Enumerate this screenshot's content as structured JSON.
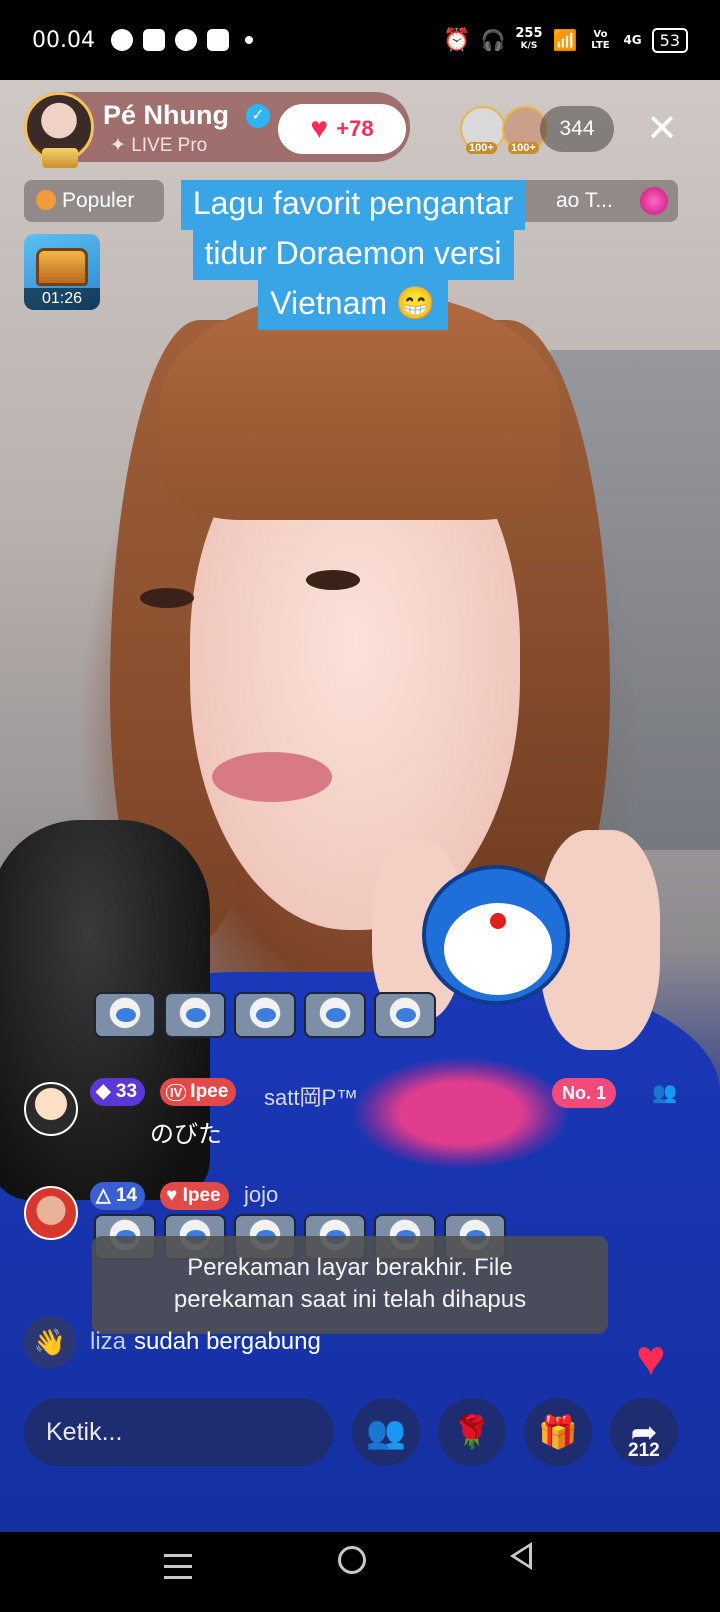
{
  "status_bar": {
    "time": "00.04",
    "speed_value": "255",
    "speed_unit": "K/S",
    "network_label": "Vo LTE",
    "signal_label": "4G",
    "battery": "53"
  },
  "live": {
    "host_name": "Pé Nhung",
    "host_subtitle": "✦ LIVE Pro",
    "likes": "+78",
    "viewer_badges": [
      "100+",
      "100+"
    ],
    "viewer_count": "344"
  },
  "chips": {
    "popular": "Populer",
    "right_chip": "ao T..."
  },
  "caption": {
    "lines": [
      "Lagu favorit pengantar",
      "tidur Doraemon versi",
      "Vietnam 😁"
    ]
  },
  "treasure": {
    "timer": "01:26"
  },
  "chat": [
    {
      "level": "33",
      "fan_badge": "Ipee",
      "fan_level": "IV",
      "name": "satt岡P™",
      "text": "のびた"
    },
    {
      "level": "14",
      "fan_badge": "Ipee",
      "name": "jojo",
      "text": ""
    }
  ],
  "rank_badge": "No. 1",
  "toast": {
    "line1": "Perekaman layar berakhir. File",
    "line2": "perekaman saat ini telah dihapus"
  },
  "join": {
    "name": "liza",
    "message": "sudah bergabung"
  },
  "bottom_bar": {
    "input_placeholder": "Ketik...",
    "share_count": "212"
  },
  "colors": {
    "caption_bg": "#3aa5e6",
    "like_heart": "#ff2d55",
    "verified": "#2fb4f5"
  }
}
